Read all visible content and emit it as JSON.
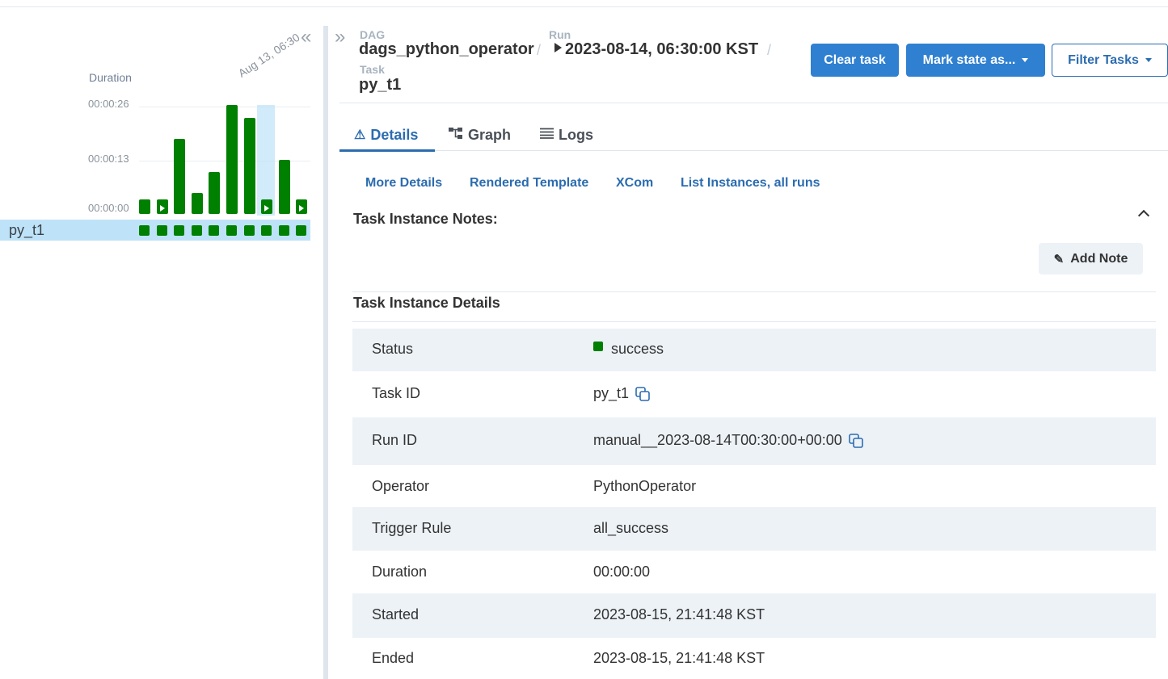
{
  "grid": {
    "duration_label": "Duration",
    "y_ticks": [
      "00:00:26",
      "00:00:13",
      "00:00:00"
    ],
    "hover_date": "Aug 13, 06:30",
    "task_name": "py_t1",
    "run_states": [
      "success",
      "success",
      "success",
      "success",
      "success",
      "success",
      "success",
      "success",
      "success",
      "success"
    ],
    "status_color": "#008000"
  },
  "chart_data": {
    "type": "bar",
    "title": "",
    "ylabel": "Duration",
    "y_ticks": [
      "00:00:26",
      "00:00:13",
      "00:00:00"
    ],
    "ylim_seconds": [
      0,
      26
    ],
    "values_seconds": [
      2,
      2,
      18,
      5,
      10,
      26,
      23,
      2,
      13,
      2
    ],
    "manual_run": [
      false,
      true,
      false,
      false,
      false,
      false,
      false,
      true,
      false,
      true
    ],
    "highlighted_index": 7
  },
  "breadcrumb": {
    "dag_label": "DAG",
    "dag_value": "dags_python_operator",
    "run_label": "Run",
    "run_value": "2023-08-14, 06:30:00 KST",
    "task_label": "Task",
    "task_value": "py_t1",
    "separator": "/"
  },
  "actions": {
    "clear_task": "Clear task",
    "mark_state": "Mark state as...",
    "filter_tasks": "Filter Tasks"
  },
  "tabs": [
    "Details",
    "Graph",
    "Logs"
  ],
  "subtabs": [
    "More Details",
    "Rendered Template",
    "XCom",
    "List Instances, all runs"
  ],
  "notes": {
    "title": "Task Instance Notes:",
    "add_note": "Add Note"
  },
  "details": {
    "title": "Task Instance Details",
    "rows": [
      {
        "key": "Status",
        "value": "success"
      },
      {
        "key": "Task ID",
        "value": "py_t1"
      },
      {
        "key": "Run ID",
        "value": "manual__2023-08-14T00:30:00+00:00"
      },
      {
        "key": "Operator",
        "value": "PythonOperator"
      },
      {
        "key": "Trigger Rule",
        "value": "all_success"
      },
      {
        "key": "Duration",
        "value": "00:00:00"
      },
      {
        "key": "Started",
        "value": "2023-08-15, 21:41:48 KST"
      },
      {
        "key": "Ended",
        "value": "2023-08-15, 21:41:48 KST"
      }
    ]
  },
  "colors": {
    "accent": "#2b6cb0",
    "button_blue": "#2f80d1",
    "success": "#008000",
    "row_shade": "#edf2f7",
    "selection": "#bee3f8"
  }
}
